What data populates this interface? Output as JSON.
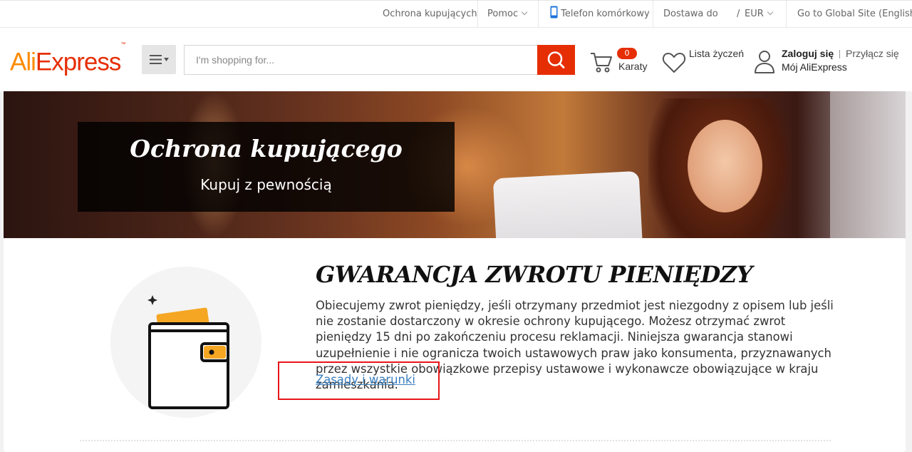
{
  "topbar": {
    "buyer_protection": "Ochrona kupujących",
    "help": "Pomoc",
    "mobile": "Telefon komórkowy",
    "ship_to": "Dostawa do",
    "separator": "/",
    "currency": "EUR",
    "global_site": "Go to Global Site (English)"
  },
  "header": {
    "logo_prefix": "Ali",
    "logo_main": "Express",
    "logo_tm": "™",
    "search_placeholder": "I'm shopping for...",
    "cart_count": "0",
    "cart_label": "Karaty",
    "wishlist_label": "Lista życzeń",
    "signin": "Zaloguj się",
    "join": "Przyłącz się",
    "my_account": "Mój AliExpress"
  },
  "banner": {
    "title": "Ochrona kupującego",
    "subtitle": "Kupuj z pewnością"
  },
  "content": {
    "title": "GWARANCJA ZWROTU PIENIĘDZY",
    "paragraph": "Obiecujemy zwrot pieniędzy, jeśli otrzymany przedmiot jest niezgodny z opisem lub jeśli nie zostanie dostarczony w okresie ochrony kupującego. Możesz otrzymać zwrot pieniędzy 15 dni po zakończeniu procesu reklamacji. Niniejsza gwarancja stanowi uzupełnienie i nie ogranicza twoich ustawowych praw jako konsumenta, przyznawanych przez wszystkie obowiązkowe przepisy ustawowe i wykonawcze obowiązujące w kraju zamieszkania.",
    "terms_link": "Zasady i warunki"
  },
  "colors": {
    "brand_red": "#e62e04",
    "brand_orange": "#ff8a00",
    "link_blue": "#3a7fbf",
    "highlight_red": "#e8161a"
  },
  "icons": [
    "phone-icon",
    "menu-icon",
    "search-icon",
    "cart-icon",
    "heart-icon",
    "user-icon",
    "wallet-icon",
    "sparkle-icon"
  ]
}
